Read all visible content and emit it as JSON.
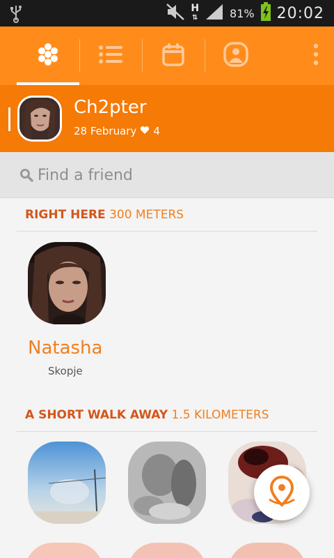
{
  "status_bar": {
    "battery_percent": "81%",
    "time": "20:02",
    "network_type": "H",
    "icons": [
      "usb-icon",
      "mute-icon",
      "network-h-icon",
      "signal-icon",
      "battery-charging-icon"
    ]
  },
  "tabs": [
    {
      "name": "chapters",
      "icon": "honeycomb-icon",
      "selected": true
    },
    {
      "name": "list",
      "icon": "list-icon",
      "selected": false
    },
    {
      "name": "calendar",
      "icon": "calendar-icon",
      "selected": false
    },
    {
      "name": "profile",
      "icon": "profile-badge-icon",
      "selected": false
    }
  ],
  "chapter": {
    "title": "Ch2pter",
    "date": "28 February",
    "likes": "4"
  },
  "search": {
    "placeholder": "Find a friend"
  },
  "sections": [
    {
      "label": "RIGHT HERE",
      "distance": "300 METERS",
      "people": [
        {
          "name": "Natasha",
          "city": "Skopje"
        }
      ]
    },
    {
      "label": "A SHORT WALK AWAY",
      "distance": "1.5 KILOMETERS"
    }
  ],
  "colors": {
    "tab_bar": "#ff8c1a",
    "chapter_bar": "#f57a06",
    "accent_text": "#f07f1f",
    "section_label": "#d4561a"
  }
}
